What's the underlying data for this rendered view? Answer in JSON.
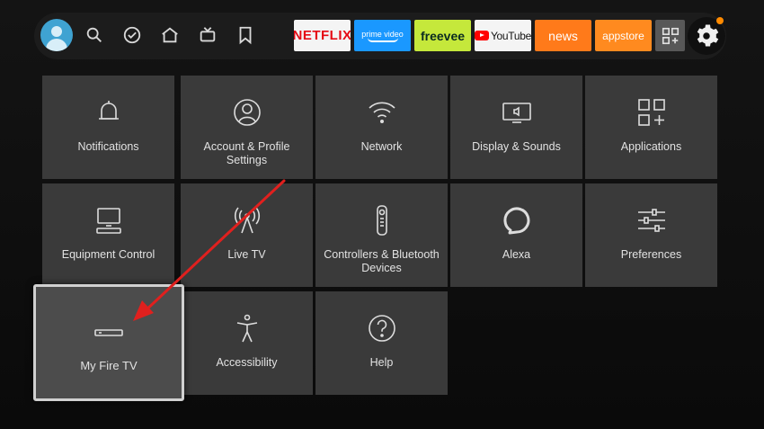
{
  "nav": {
    "icons": [
      "profile-avatar",
      "search-icon",
      "check-circle-icon",
      "home-icon",
      "live-tv-icon",
      "bookmark-icon",
      "settings-gear-icon"
    ],
    "apps": [
      {
        "name": "netflix",
        "label": "NETFLIX",
        "color": "#e50914"
      },
      {
        "name": "prime-video",
        "label": "prime video",
        "color": "#1a98ff"
      },
      {
        "name": "freevee",
        "label": "freevee",
        "color": "#c5e83b"
      },
      {
        "name": "youtube",
        "label": "YouTube",
        "color": "#ff0000"
      },
      {
        "name": "news",
        "label": "news",
        "color": "#ff7a1a"
      },
      {
        "name": "appstore",
        "label": "appstore",
        "color": "#ff8a1f"
      }
    ],
    "accent_dot_color": "#ff8a00"
  },
  "tiles": [
    {
      "label": "Notifications",
      "icon": "bell-icon"
    },
    {
      "label": "Account & Profile Settings",
      "icon": "account-icon"
    },
    {
      "label": "Network",
      "icon": "wifi-icon"
    },
    {
      "label": "Display & Sounds",
      "icon": "display-sound-icon"
    },
    {
      "label": "Applications",
      "icon": "applications-icon"
    },
    {
      "label": "Equipment Control",
      "icon": "equipment-icon"
    },
    {
      "label": "Live TV",
      "icon": "antenna-icon"
    },
    {
      "label": "Controllers & Bluetooth Devices",
      "icon": "remote-icon"
    },
    {
      "label": "Alexa",
      "icon": "alexa-icon"
    },
    {
      "label": "Preferences",
      "icon": "sliders-icon"
    },
    {
      "label": "My Fire TV",
      "icon": "fire-tv-device-icon",
      "focused": true
    },
    {
      "label": "Accessibility",
      "icon": "accessibility-icon"
    },
    {
      "label": "Help",
      "icon": "help-icon"
    }
  ],
  "annotation": {
    "type": "red-arrow",
    "points_to": "My Fire TV",
    "color": "#e0201e"
  }
}
